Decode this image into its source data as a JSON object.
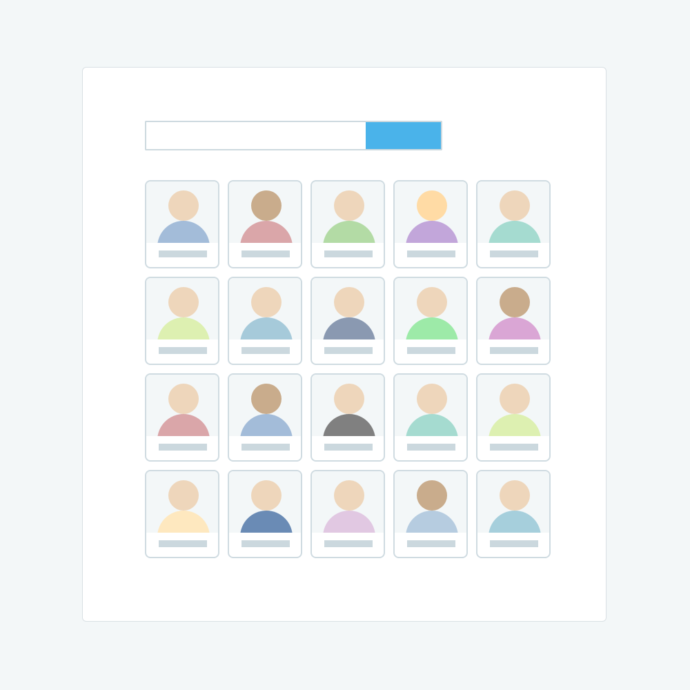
{
  "search": {
    "value": "",
    "placeholder": "",
    "button_label": "",
    "button_color": "#4ab3ea"
  },
  "contacts": [
    {
      "name": "",
      "head_color": "#eed6bb",
      "body_color": "#a3bcd9"
    },
    {
      "name": "",
      "head_color": "#c9ac8c",
      "body_color": "#daa6a9"
    },
    {
      "name": "",
      "head_color": "#eed6bb",
      "body_color": "#b3dba5"
    },
    {
      "name": "",
      "head_color": "#ffdba5",
      "body_color": "#c2a6da"
    },
    {
      "name": "",
      "head_color": "#eed6bb",
      "body_color": "#a5dbd0"
    },
    {
      "name": "",
      "head_color": "#eed6bb",
      "body_color": "#ddf0b1"
    },
    {
      "name": "",
      "head_color": "#eed6bb",
      "body_color": "#a6cada"
    },
    {
      "name": "",
      "head_color": "#eed6bb",
      "body_color": "#8a99b1"
    },
    {
      "name": "",
      "head_color": "#eed6bb",
      "body_color": "#9deaa8"
    },
    {
      "name": "",
      "head_color": "#c9ac8c",
      "body_color": "#daa6d5"
    },
    {
      "name": "",
      "head_color": "#eed6bb",
      "body_color": "#daa6a9"
    },
    {
      "name": "",
      "head_color": "#c9ac8c",
      "body_color": "#a3bcd9"
    },
    {
      "name": "",
      "head_color": "#eed6bb",
      "body_color": "#808080"
    },
    {
      "name": "",
      "head_color": "#eed6bb",
      "body_color": "#a5dbd0"
    },
    {
      "name": "",
      "head_color": "#eed6bb",
      "body_color": "#ddf0b1"
    },
    {
      "name": "",
      "head_color": "#eed6bb",
      "body_color": "#fee8bf"
    },
    {
      "name": "",
      "head_color": "#eed6bb",
      "body_color": "#6a8bb5"
    },
    {
      "name": "",
      "head_color": "#eed6bb",
      "body_color": "#e1c8e2"
    },
    {
      "name": "",
      "head_color": "#c9ac8c",
      "body_color": "#b6cce0"
    },
    {
      "name": "",
      "head_color": "#eed6bb",
      "body_color": "#a6cfdc"
    }
  ]
}
